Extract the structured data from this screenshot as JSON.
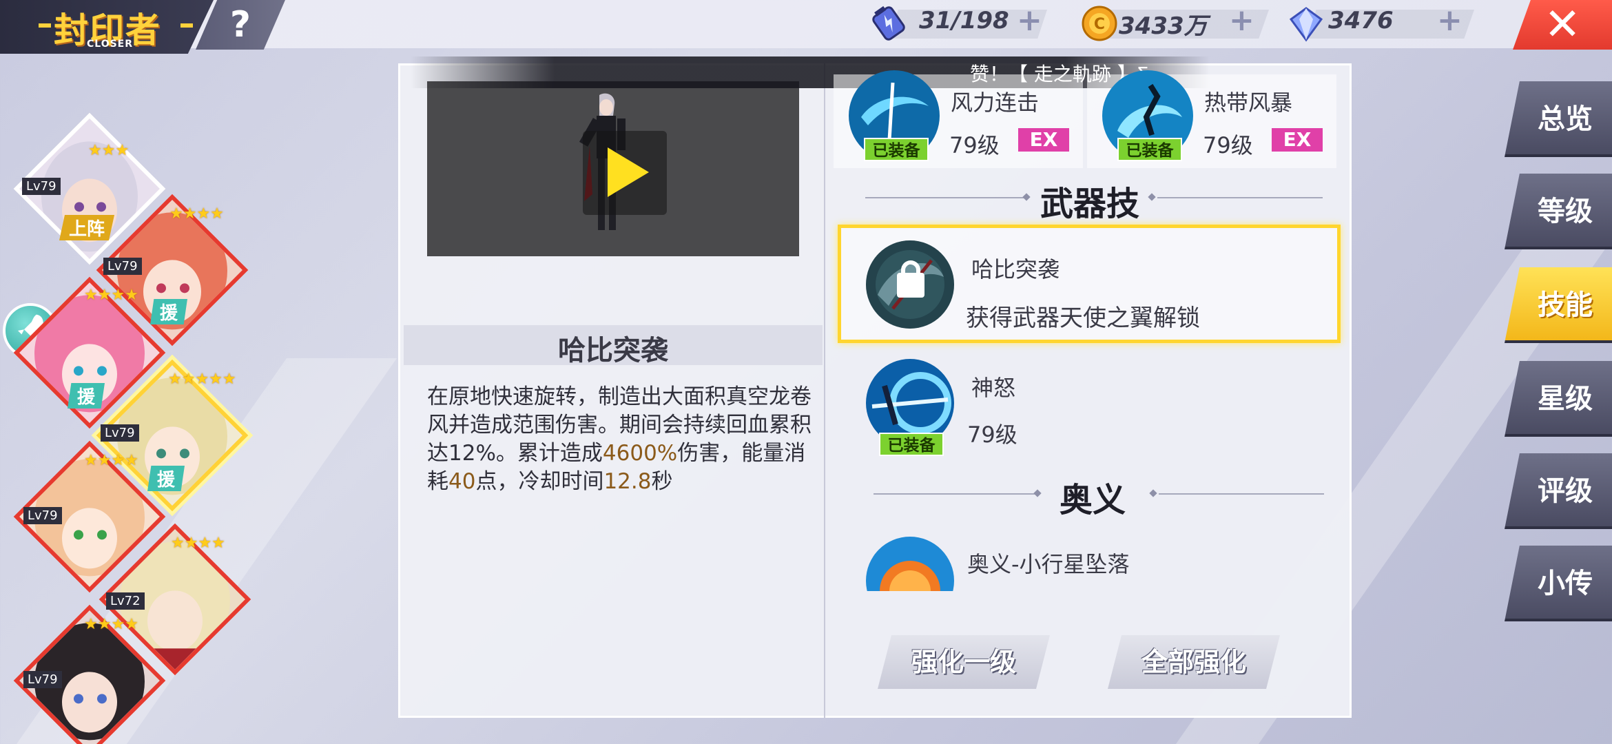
{
  "header": {
    "logo_title": "封印者",
    "logo_subtitle": "CLOSER",
    "help_label": "?",
    "resources": [
      {
        "name": "stamina",
        "icon": "battery-icon",
        "value": "31/198"
      },
      {
        "name": "gold",
        "icon": "coin-icon",
        "value": "3433万"
      },
      {
        "name": "gems",
        "icon": "diamond-icon",
        "value": "3476"
      }
    ],
    "plus_label": "+",
    "close_label": "✕"
  },
  "notice": {
    "text": "赞！【 走之軌跡 】Σ"
  },
  "roster": [
    {
      "level": "Lv79",
      "tag": "上阵"
    },
    {
      "level": "Lv79",
      "tag": "援"
    },
    {
      "level": "",
      "tag": "援"
    },
    {
      "level": "Lv79",
      "tag": "援"
    },
    {
      "level": "Lv79",
      "tag": ""
    },
    {
      "level": "Lv72",
      "tag": ""
    },
    {
      "level": "Lv79",
      "tag": ""
    }
  ],
  "detail": {
    "skill_name": "哈比突袭",
    "desc_1": "在原地快速旋转，制造出大面积真空龙卷风并造成范围伤害。期间会持续回血累积达12%。累计造成",
    "desc_hl1": "4600%",
    "desc_2": "伤害，能量消耗",
    "desc_hl2": "40",
    "desc_3": "点，冷却时间",
    "desc_hl3": "12.8",
    "desc_4": "秒"
  },
  "skills": {
    "top": [
      {
        "name": "风力连击",
        "level": "79级",
        "badge": "EX",
        "status": "已装备"
      },
      {
        "name": "热带风暴",
        "level": "79级",
        "badge": "EX",
        "status": "已装备"
      }
    ],
    "weapon_section": "武器技",
    "weapon_selected": {
      "name": "哈比突袭",
      "unlock": "获得武器天使之翼解锁"
    },
    "weapon_other": {
      "name": "神怒",
      "level": "79级",
      "status": "已装备"
    },
    "ultimate_section": "奥义",
    "ultimate": {
      "name": "奥义-小行星坠落"
    }
  },
  "actions": {
    "upgrade_one": "强化一级",
    "upgrade_all": "全部强化"
  },
  "tabs": [
    "总览",
    "等级",
    "技能",
    "星级",
    "评级",
    "小传"
  ],
  "colors": {
    "accent": "#ffd52e",
    "equipped": "#7cd12f",
    "ex": "#e040a8",
    "close": "#e33a2e"
  }
}
